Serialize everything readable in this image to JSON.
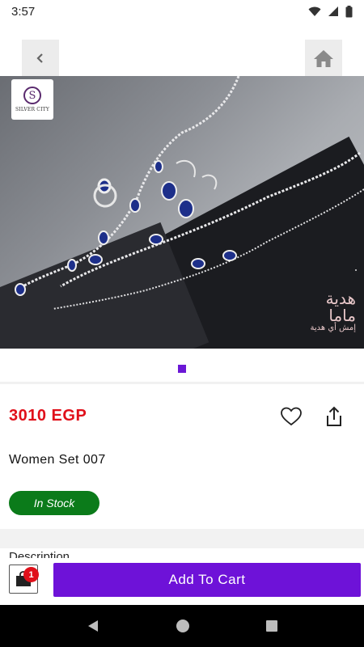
{
  "status_bar": {
    "time": "3:57"
  },
  "gallery": {
    "brand_logo_text": "SILVER CITY",
    "watermark_line1": "هدية",
    "watermark_line2": "ماما",
    "watermark_line3": "إمش أي هدية",
    "dot_count": 1,
    "active_dot": 0,
    "accent_color": "#6b17d6"
  },
  "product": {
    "price": "3010 EGP",
    "title": "Women Set 007",
    "stock_status": "In Stock",
    "description_heading": "Description"
  },
  "bottom_bar": {
    "cart_count": "1",
    "add_to_cart_label": "Add To Cart"
  },
  "icons": {
    "back": "chevron-left-icon",
    "home": "home-icon",
    "favorite": "heart-outline-icon",
    "share": "share-icon",
    "cart": "shopping-bag-icon"
  },
  "colors": {
    "price": "#e0101a",
    "stock_badge": "#0b7b1a",
    "primary_button": "#6e12d8"
  }
}
